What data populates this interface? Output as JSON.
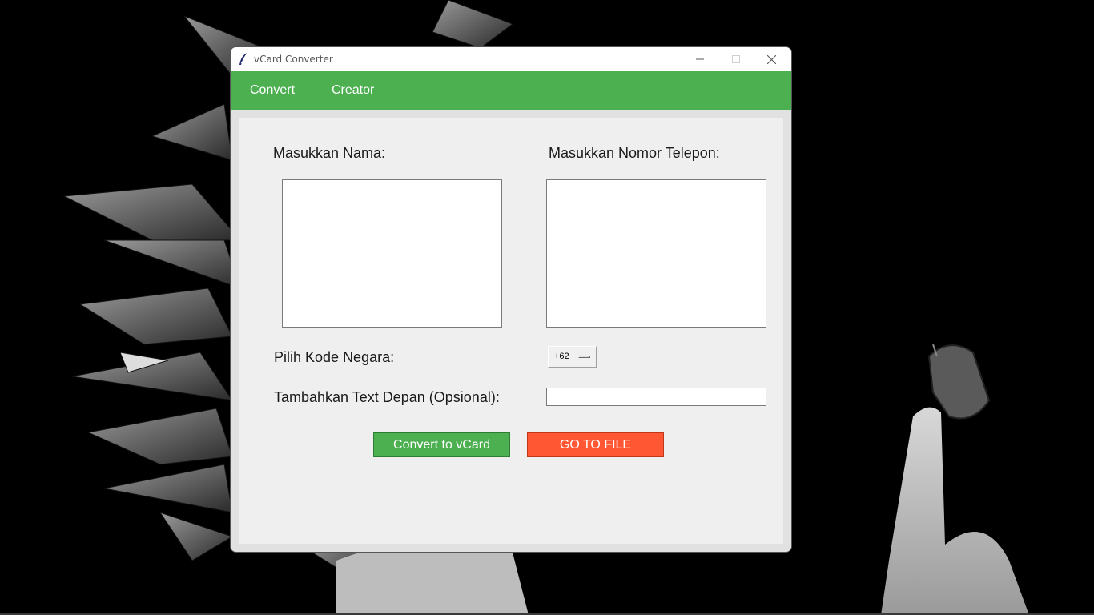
{
  "window": {
    "title": "vCard Converter"
  },
  "menu": {
    "items": [
      "Convert",
      "Creator"
    ]
  },
  "form": {
    "name_label": "Masukkan Nama:",
    "phone_label": "Masukkan Nomor Telepon:",
    "name_value": "",
    "phone_value": "",
    "country_code_label": "Pilih Kode Negara:",
    "country_code_value": "+62",
    "prefix_label": "Tambahkan Text Depan (Opsional):",
    "prefix_value": ""
  },
  "actions": {
    "convert_label": "Convert to vCard",
    "go_to_file_label": "GO TO FILE"
  },
  "colors": {
    "accent_green": "#4caf50",
    "accent_orange": "#ff5733",
    "background": "#f0f0f0"
  },
  "icons": {
    "app": "feather-icon",
    "minimize": "minimize-icon",
    "maximize": "maximize-icon",
    "close": "close-icon"
  }
}
